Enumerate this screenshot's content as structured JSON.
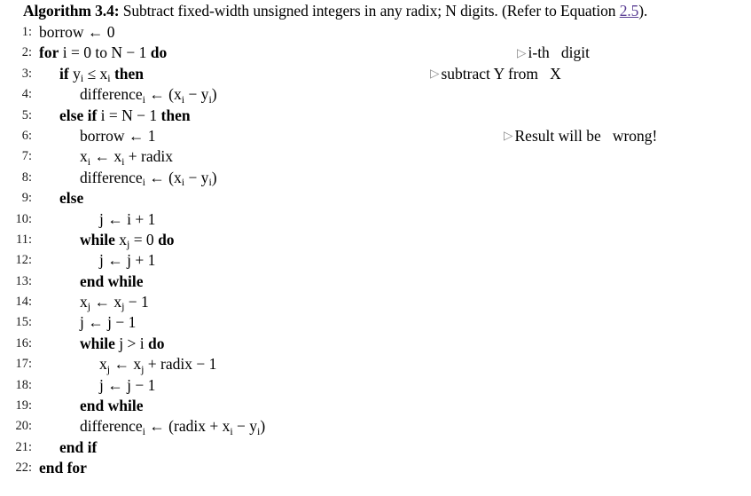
{
  "title": {
    "label": "Algorithm 3.4:",
    "text_before": " Subtract fixed-width unsigned integers in any radix; N digits. (Refer to Equation ",
    "equation_ref": "2.5",
    "text_after": ")."
  },
  "colors": {
    "link": "#5b3f94",
    "text": "#000000",
    "comment_marker": "#8a8a8a",
    "background": "#ffffff"
  },
  "comment_marker": "▷",
  "lines": [
    {
      "num": "1",
      "indent": 0,
      "text": "borrow ← 0"
    },
    {
      "num": "2",
      "indent": 0,
      "text": "for i = 0 to N − 1 do"
    },
    {
      "num": "3",
      "indent": 1,
      "text": "if yi ≤ xi then"
    },
    {
      "num": "4",
      "indent": 2,
      "text": "differencei ← (xi − yi)"
    },
    {
      "num": "5",
      "indent": 1,
      "text": "else if i = N − 1 then"
    },
    {
      "num": "6",
      "indent": 2,
      "text": "borrow ← 1"
    },
    {
      "num": "7",
      "indent": 2,
      "text": "xi ← xi + radix"
    },
    {
      "num": "8",
      "indent": 2,
      "text": "differencei ← (xi − yi)"
    },
    {
      "num": "9",
      "indent": 1,
      "text": "else"
    },
    {
      "num": "10",
      "indent": 2,
      "text": "j ← i + 1"
    },
    {
      "num": "11",
      "indent": 2,
      "text": "while xj = 0 do"
    },
    {
      "num": "12",
      "indent": 3,
      "text": "j ← j + 1"
    },
    {
      "num": "13",
      "indent": 2,
      "text": "end while"
    },
    {
      "num": "14",
      "indent": 2,
      "text": "xj ← xj − 1"
    },
    {
      "num": "15",
      "indent": 2,
      "text": "j ← j − 1"
    },
    {
      "num": "16",
      "indent": 2,
      "text": "while j > i do"
    },
    {
      "num": "17",
      "indent": 3,
      "text": "xj ← xj + radix − 1"
    },
    {
      "num": "18",
      "indent": 3,
      "text": "j ← j − 1"
    },
    {
      "num": "19",
      "indent": 2,
      "text": "end while"
    },
    {
      "num": "20",
      "indent": 2,
      "text": "differencei ← (radix + xi − yi)"
    },
    {
      "num": "21",
      "indent": 1,
      "text": "end if"
    },
    {
      "num": "22",
      "indent": 0,
      "text": "end for"
    }
  ],
  "comments": [
    {
      "on_line": "2",
      "text": "i-th   digit"
    },
    {
      "on_line": "3",
      "text": "subtract Y from   X"
    },
    {
      "on_line": "6",
      "text": "Result will be   wrong!"
    }
  ]
}
